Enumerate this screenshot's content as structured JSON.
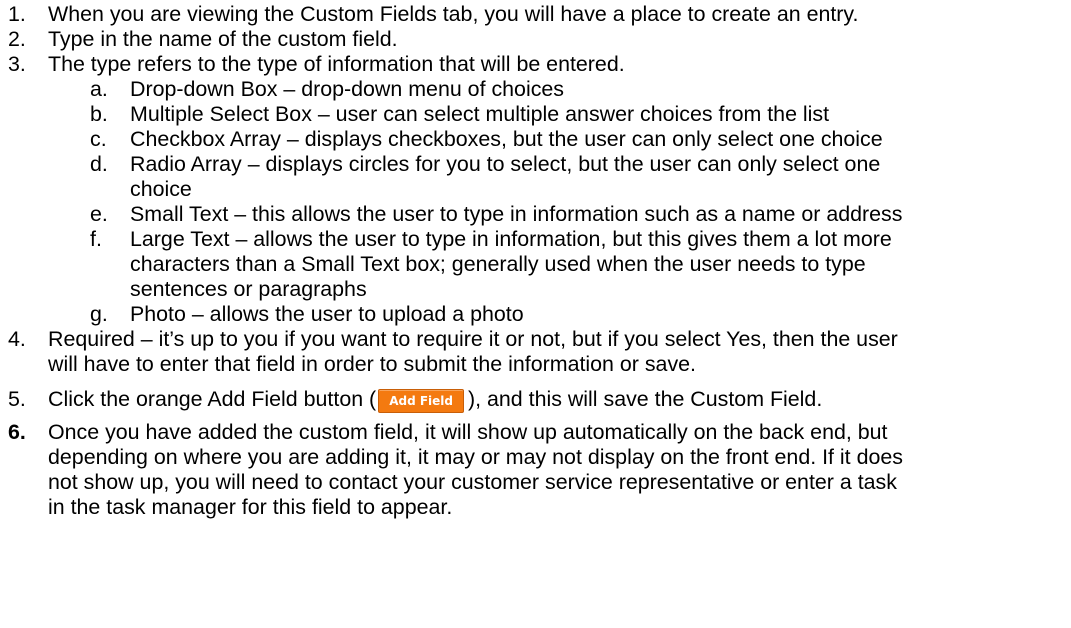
{
  "items": [
    {
      "num": "1.",
      "lines": [
        "When you are viewing the Custom Fields tab, you will have a place to create an entry."
      ]
    },
    {
      "num": "2.",
      "lines": [
        "Type in the name of the custom field."
      ]
    },
    {
      "num": "3.",
      "lines": [
        "The type refers to the type of information that will be entered."
      ]
    },
    {
      "num": "4.",
      "lines": [
        "Required – it’s up to you if you want to require it or not, but if you select Yes, then the user",
        "will have to enter that field in order to submit the information or save."
      ]
    },
    {
      "num": "5.",
      "before": "Click the orange Add Field button (",
      "button": "Add Field",
      "after": "), and this will save the Custom Field."
    },
    {
      "num": "6.",
      "lines": [
        "Once you have added the custom field, it will show up automatically on the back end, but",
        "depending on where you are adding it, it may or may not display on the front end. If it does",
        "not show up, you will need to contact your customer service representative or enter a task",
        "in the task manager for this field to appear."
      ]
    }
  ],
  "subitems": [
    {
      "letter": "a.",
      "lines": [
        "Drop-down Box – drop-down menu of choices"
      ]
    },
    {
      "letter": "b.",
      "lines": [
        "Multiple Select Box – user can select multiple answer choices from the list"
      ]
    },
    {
      "letter": "c.",
      "lines": [
        "Checkbox Array – displays checkboxes, but the user can only select one choice"
      ]
    },
    {
      "letter": "d.",
      "lines": [
        "Radio Array – displays circles for you to select, but the user can only select one",
        "choice"
      ]
    },
    {
      "letter": "e.",
      "lines": [
        "Small Text – this allows the user to type in information such as a name or address"
      ]
    },
    {
      "letter": "f.",
      "lines": [
        "Large Text – allows the user to type in information, but this gives them a lot more",
        "characters than a Small Text box; generally used when the user needs to type",
        "sentences or paragraphs"
      ]
    },
    {
      "letter": "g.",
      "lines": [
        "Photo – allows the user to upload a photo"
      ]
    }
  ],
  "colors": {
    "button_bg": "#f47a10",
    "button_text": "#ffffff"
  }
}
